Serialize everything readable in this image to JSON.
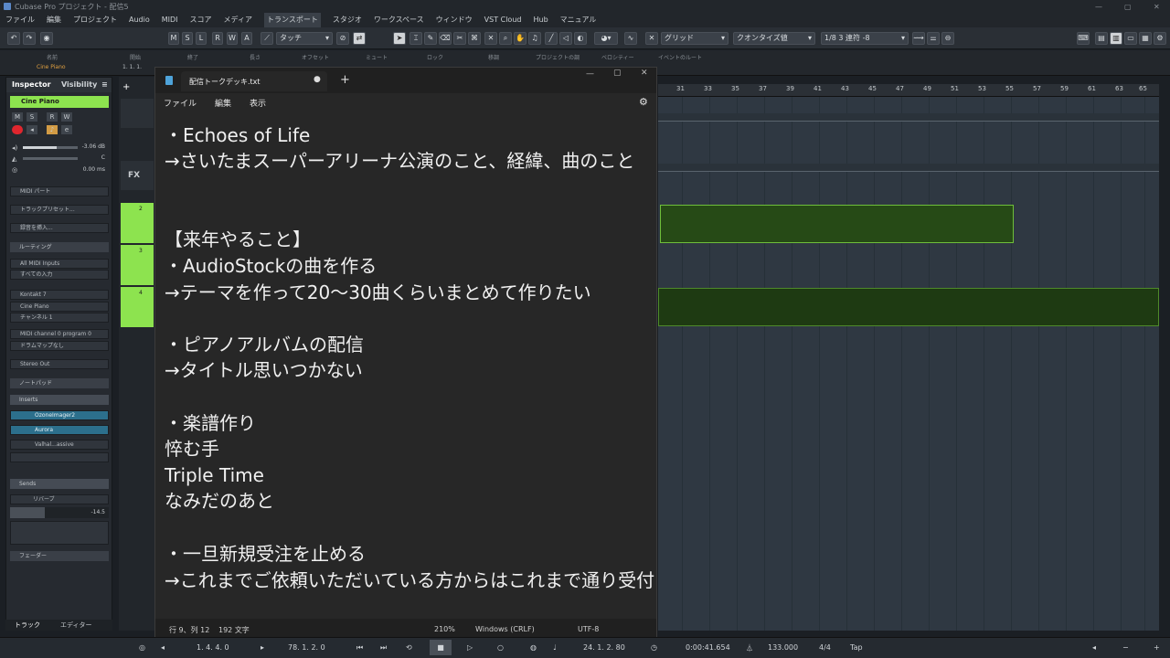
{
  "window": {
    "title": "Cubase Pro プロジェクト - 配信5"
  },
  "menu": [
    "ファイル",
    "編集",
    "プロジェクト",
    "Audio",
    "MIDI",
    "スコア",
    "メディア",
    "トランスポート",
    "スタジオ",
    "ワークスペース",
    "ウィンドウ",
    "VST Cloud",
    "Hub",
    "マニュアル"
  ],
  "toolbar": {
    "mode_buttons": [
      "M",
      "S",
      "L",
      "R",
      "W",
      "A"
    ],
    "automation_mode": "タッチ",
    "grid_label": "グリッド",
    "quantize_label": "クオンタイズ値",
    "quantize_value": "1/8 3 連符 -8"
  },
  "infoline": {
    "headers": [
      "名前",
      "開始",
      "終了",
      "長さ",
      "オフセット",
      "ミュート",
      "ロック",
      "移調",
      "プロジェクトの調",
      "ベロシティー",
      "イベントのルート"
    ],
    "name_value": "Cine Piano",
    "start_value": "1. 1. 1."
  },
  "inspector": {
    "tabs": [
      "Inspector",
      "Visibility"
    ],
    "track_name": "Cine Piano",
    "volume": "-3.06 dB",
    "pan": "C",
    "delay": "0.00 ms",
    "midi_part": "MIDI パート",
    "track_preset": "トラックプリセット...",
    "notes": "録音を挿入...",
    "routing_label": "ルーティング",
    "midi_input": "All MIDI Inputs",
    "midi_input_sub": "すべての入力",
    "instrument": "Kontakt 7",
    "instrument_patch": "Cine Piano",
    "channel": "チャンネル 1",
    "program": "MIDI channel 0 program 0",
    "drum_map": "ドラムマップなし",
    "output": "Stereo Out",
    "notepad_label": "ノートパッド",
    "inserts_label": "Inserts",
    "inserts": [
      "OzoneImager2",
      "Aurora",
      "Valhal...assive"
    ],
    "sends_label": "Sends",
    "send_name": "リバーブ",
    "send_value": "-14.5",
    "fader_label": "フェーダー",
    "bottom_tabs": [
      "トラック",
      "エディター"
    ]
  },
  "tracks": [
    {
      "num": "2"
    },
    {
      "num": "3"
    },
    {
      "num": "4"
    }
  ],
  "ruler": [
    "31",
    "33",
    "35",
    "37",
    "39",
    "41",
    "43",
    "45",
    "47",
    "49",
    "51",
    "53",
    "55",
    "57",
    "59",
    "61",
    "63",
    "65"
  ],
  "notepad": {
    "tab_title": "配信トークデッキ.txt",
    "menu": [
      "ファイル",
      "編集",
      "表示"
    ],
    "lines": [
      "・Echoes of Life",
      "→さいたまスーパーアリーナ公演のこと、経緯、曲のこと",
      "",
      "",
      "【来年やること】",
      "・AudioStockの曲を作る",
      "→テーマを作って20～30曲くらいまとめて作りたい",
      "",
      "・ピアノアルバムの配信",
      "→タイトル思いつかない",
      "",
      "・楽譜作り",
      "悴む手",
      "Triple Time",
      "なみだのあと",
      "",
      "・一旦新規受注を止める",
      "→これまでご依頼いただいている方からはこれまで通り受付"
    ],
    "status": {
      "position": "行 9、列 12",
      "chars": "192 文字",
      "zoom": "210%",
      "eol": "Windows (CRLF)",
      "encoding": "UTF-8"
    }
  },
  "transport": {
    "left_locator": "1. 4. 4. 0",
    "right_locator": "78. 1. 2. 0",
    "position_bars": "24. 1. 2. 80",
    "position_time": "0:00:41.654",
    "tempo": "133.000",
    "signature": "4/4",
    "tap": "Tap"
  },
  "colors": {
    "accent_green": "#39b54a",
    "track_green": "#8de34f",
    "record": "#e0262e"
  }
}
